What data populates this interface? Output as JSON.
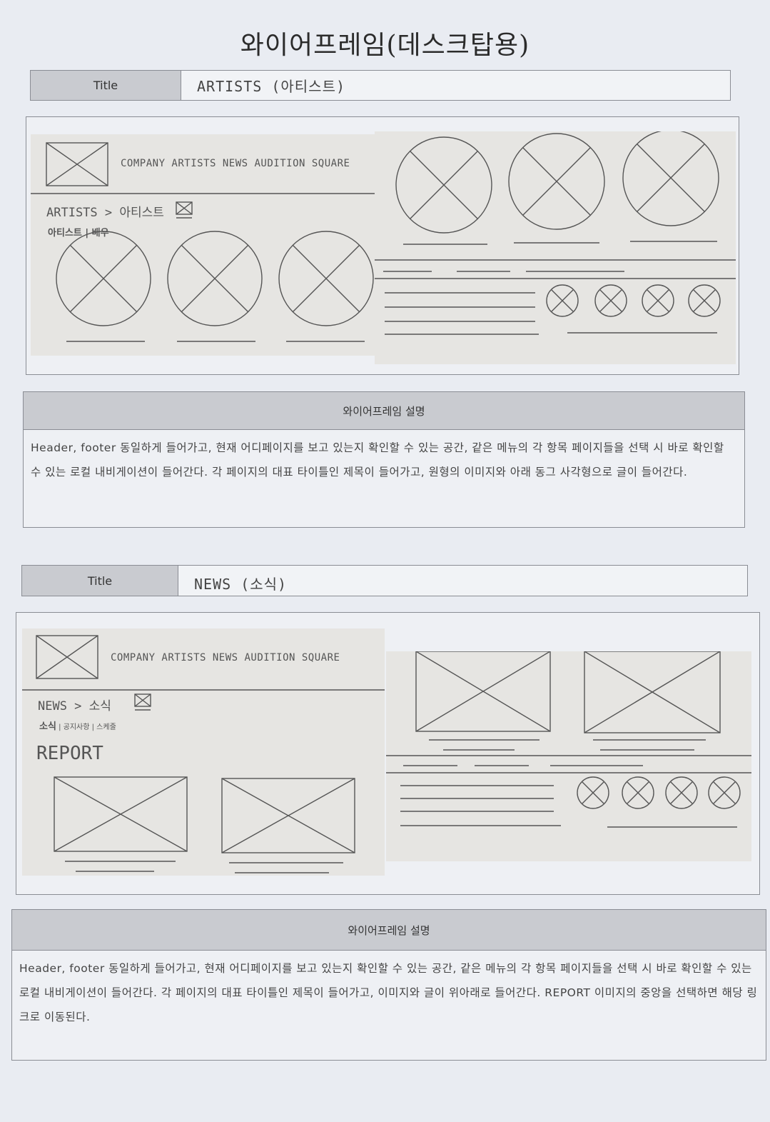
{
  "document": {
    "title": "와이어프레임(데스크탑용)"
  },
  "sections": [
    {
      "title_label": "Title",
      "title_value": "ARTISTS (아티스트)",
      "nav": "COMPANY ARTISTS NEWS AUDITION SQUARE",
      "breadcrumb": "ARTISTS > 아티스트",
      "submenu": "아티스트 | 배우",
      "desc_header": "와이어프레임 설명",
      "desc_text": "Header, footer 동일하게 들어가고, 현재 어디페이지를 보고 있는지 확인할 수 있는 공간, 같은 메뉴의 각 항목 페이지들을 선택 시 바로 확인할 수 있는 로컬 내비게이션이 들어간다. 각 페이지의 대표 타이틀인 제목이 들어가고, 원형의 이미지와 아래 동그 사각형으로 글이 들어간다."
    },
    {
      "title_label": "Title",
      "title_value": "NEWS (소식)",
      "nav": "COMPANY ARTISTS NEWS AUDITION SQUARE",
      "breadcrumb": "NEWS > 소식",
      "submenu_main": "소식",
      "submenu_rest": " | 공지사항 | 스케줄",
      "heading": "REPORT",
      "desc_header": "와이어프레임 설명",
      "desc_text": "Header, footer 동일하게 들어가고, 현재 어디페이지를 보고 있는지 확인할 수 있는 공간, 같은 메뉴의 각 항목 페이지들을 선택 시 바로 확인할 수 있는 로컬 내비게이션이 들어간다. 각 페이지의 대표 타이틀인 제목이 들어가고, 이미지와 글이 위아래로 들어간다. REPORT 이미지의 중앙을 선택하면 해당 링크로 이동된다."
    }
  ]
}
